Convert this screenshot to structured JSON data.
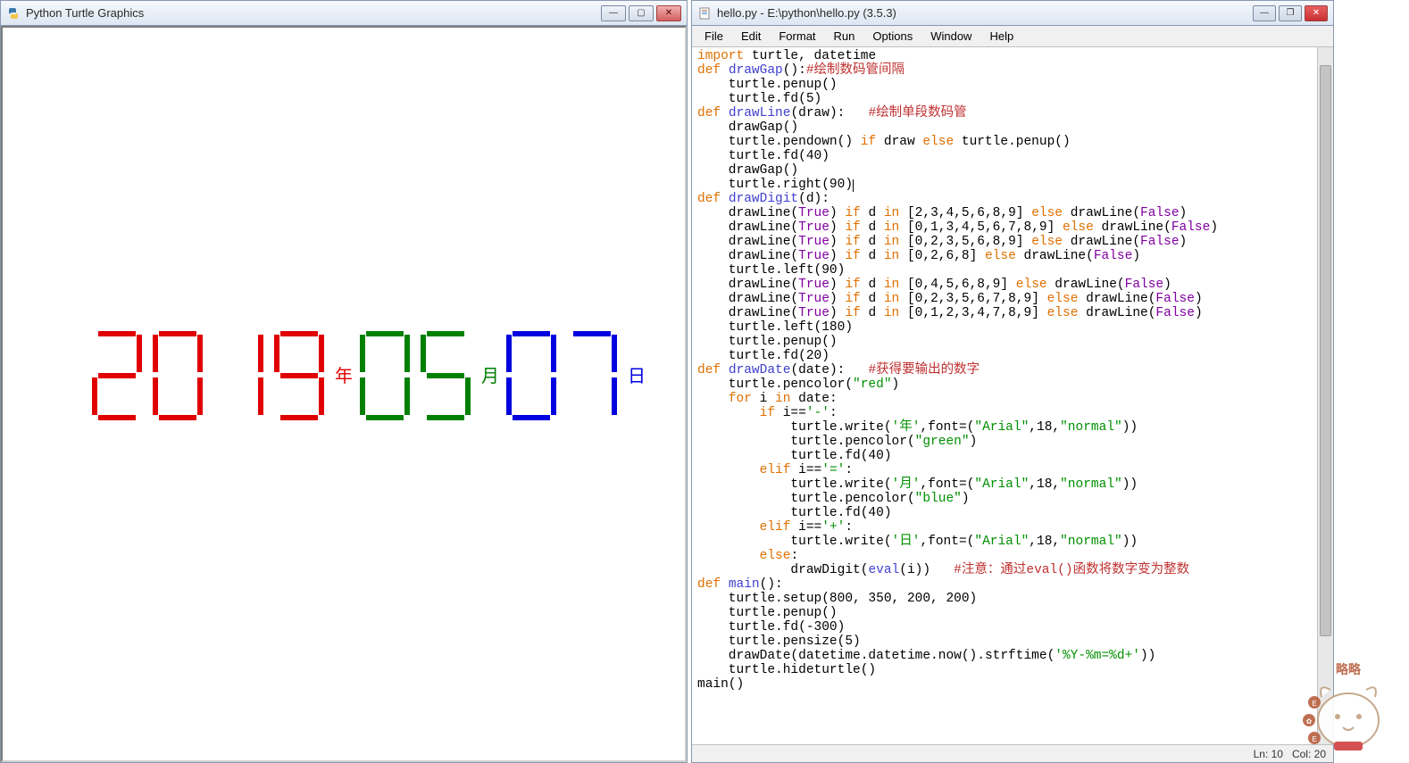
{
  "turtle_window": {
    "title": "Python Turtle Graphics",
    "date": {
      "year": "2019",
      "month": "05",
      "day": "07",
      "year_label": "年",
      "month_label": "月",
      "day_label": "日",
      "year_color": "red",
      "month_color": "green",
      "day_color": "blue"
    }
  },
  "idle_window": {
    "title": "hello.py - E:\\python\\hello.py (3.5.3)",
    "menus": [
      "File",
      "Edit",
      "Format",
      "Run",
      "Options",
      "Window",
      "Help"
    ],
    "status": {
      "ln": "Ln: 10",
      "col": "Col: 20"
    },
    "code_lines": [
      [
        [
          "kw",
          "import"
        ],
        [
          "",
          " turtle, datetime"
        ]
      ],
      [
        [
          "kw",
          "def"
        ],
        [
          "",
          " "
        ],
        [
          "fn",
          "drawGap"
        ],
        [
          "",
          "():"
        ],
        [
          "com",
          "#绘制数码管间隔"
        ]
      ],
      [
        [
          "",
          "    turtle.penup()"
        ]
      ],
      [
        [
          "",
          "    turtle.fd(5)"
        ]
      ],
      [
        [
          "kw",
          "def"
        ],
        [
          "",
          " "
        ],
        [
          "fn",
          "drawLine"
        ],
        [
          "",
          "(draw):   "
        ],
        [
          "com",
          "#绘制单段数码管"
        ]
      ],
      [
        [
          "",
          "    drawGap()"
        ]
      ],
      [
        [
          "",
          "    turtle.pendown() "
        ],
        [
          "kw",
          "if"
        ],
        [
          "",
          " draw "
        ],
        [
          "kw",
          "else"
        ],
        [
          "",
          " turtle.penup()"
        ]
      ],
      [
        [
          "",
          "    turtle.fd(40)"
        ]
      ],
      [
        [
          "",
          "    drawGap()"
        ]
      ],
      [
        [
          "",
          "    turtle.right(90)"
        ]
      ],
      [
        [
          "kw",
          "def"
        ],
        [
          "",
          " "
        ],
        [
          "fn",
          "drawDigit"
        ],
        [
          "",
          "(d):"
        ]
      ],
      [
        [
          "",
          "    drawLine("
        ],
        [
          "bn",
          "True"
        ],
        [
          "",
          ") "
        ],
        [
          "kw",
          "if"
        ],
        [
          "",
          " d "
        ],
        [
          "kw",
          "in"
        ],
        [
          "",
          " [2,3,4,5,6,8,9] "
        ],
        [
          "kw",
          "else"
        ],
        [
          "",
          " drawLine("
        ],
        [
          "bn",
          "False"
        ],
        [
          "",
          ")"
        ]
      ],
      [
        [
          "",
          "    drawLine("
        ],
        [
          "bn",
          "True"
        ],
        [
          "",
          ") "
        ],
        [
          "kw",
          "if"
        ],
        [
          "",
          " d "
        ],
        [
          "kw",
          "in"
        ],
        [
          "",
          " [0,1,3,4,5,6,7,8,9] "
        ],
        [
          "kw",
          "else"
        ],
        [
          "",
          " drawLine("
        ],
        [
          "bn",
          "False"
        ],
        [
          "",
          ")"
        ]
      ],
      [
        [
          "",
          "    drawLine("
        ],
        [
          "bn",
          "True"
        ],
        [
          "",
          ") "
        ],
        [
          "kw",
          "if"
        ],
        [
          "",
          " d "
        ],
        [
          "kw",
          "in"
        ],
        [
          "",
          " [0,2,3,5,6,8,9] "
        ],
        [
          "kw",
          "else"
        ],
        [
          "",
          " drawLine("
        ],
        [
          "bn",
          "False"
        ],
        [
          "",
          ")"
        ]
      ],
      [
        [
          "",
          "    drawLine("
        ],
        [
          "bn",
          "True"
        ],
        [
          "",
          ") "
        ],
        [
          "kw",
          "if"
        ],
        [
          "",
          " d "
        ],
        [
          "kw",
          "in"
        ],
        [
          "",
          " [0,2,6,8] "
        ],
        [
          "kw",
          "else"
        ],
        [
          "",
          " drawLine("
        ],
        [
          "bn",
          "False"
        ],
        [
          "",
          ")"
        ]
      ],
      [
        [
          "",
          "    turtle.left(90)"
        ]
      ],
      [
        [
          "",
          "    drawLine("
        ],
        [
          "bn",
          "True"
        ],
        [
          "",
          ") "
        ],
        [
          "kw",
          "if"
        ],
        [
          "",
          " d "
        ],
        [
          "kw",
          "in"
        ],
        [
          "",
          " [0,4,5,6,8,9] "
        ],
        [
          "kw",
          "else"
        ],
        [
          "",
          " drawLine("
        ],
        [
          "bn",
          "False"
        ],
        [
          "",
          ")"
        ]
      ],
      [
        [
          "",
          "    drawLine("
        ],
        [
          "bn",
          "True"
        ],
        [
          "",
          ") "
        ],
        [
          "kw",
          "if"
        ],
        [
          "",
          " d "
        ],
        [
          "kw",
          "in"
        ],
        [
          "",
          " [0,2,3,5,6,7,8,9] "
        ],
        [
          "kw",
          "else"
        ],
        [
          "",
          " drawLine("
        ],
        [
          "bn",
          "False"
        ],
        [
          "",
          ")"
        ]
      ],
      [
        [
          "",
          "    drawLine("
        ],
        [
          "bn",
          "True"
        ],
        [
          "",
          ") "
        ],
        [
          "kw",
          "if"
        ],
        [
          "",
          " d "
        ],
        [
          "kw",
          "in"
        ],
        [
          "",
          " [0,1,2,3,4,7,8,9] "
        ],
        [
          "kw",
          "else"
        ],
        [
          "",
          " drawLine("
        ],
        [
          "bn",
          "False"
        ],
        [
          "",
          ")"
        ]
      ],
      [
        [
          "",
          "    turtle.left(180)"
        ]
      ],
      [
        [
          "",
          "    turtle.penup()"
        ]
      ],
      [
        [
          "",
          "    turtle.fd(20)"
        ]
      ],
      [
        [
          "kw",
          "def"
        ],
        [
          "",
          " "
        ],
        [
          "fn",
          "drawDate"
        ],
        [
          "",
          "(date):   "
        ],
        [
          "com",
          "#获得要输出的数字"
        ]
      ],
      [
        [
          "",
          "    turtle.pencolor("
        ],
        [
          "str",
          "\"red\""
        ],
        [
          "",
          ")"
        ]
      ],
      [
        [
          "",
          "    "
        ],
        [
          "kw",
          "for"
        ],
        [
          "",
          " i "
        ],
        [
          "kw",
          "in"
        ],
        [
          "",
          " date:"
        ]
      ],
      [
        [
          "",
          "        "
        ],
        [
          "kw",
          "if"
        ],
        [
          "",
          " i=="
        ],
        [
          "str",
          "'-'"
        ],
        [
          "",
          ":"
        ]
      ],
      [
        [
          "",
          "            turtle.write("
        ],
        [
          "str",
          "'年'"
        ],
        [
          "",
          ",font=("
        ],
        [
          "str",
          "\"Arial\""
        ],
        [
          "",
          ",18,"
        ],
        [
          "str",
          "\"normal\""
        ],
        [
          "",
          "))"
        ]
      ],
      [
        [
          "",
          "            turtle.pencolor("
        ],
        [
          "str",
          "\"green\""
        ],
        [
          "",
          ")"
        ]
      ],
      [
        [
          "",
          "            turtle.fd(40)"
        ]
      ],
      [
        [
          "",
          "        "
        ],
        [
          "kw",
          "elif"
        ],
        [
          "",
          " i=="
        ],
        [
          "str",
          "'='"
        ],
        [
          "",
          ":"
        ]
      ],
      [
        [
          "",
          "            turtle.write("
        ],
        [
          "str",
          "'月'"
        ],
        [
          "",
          ",font=("
        ],
        [
          "str",
          "\"Arial\""
        ],
        [
          "",
          ",18,"
        ],
        [
          "str",
          "\"normal\""
        ],
        [
          "",
          "))"
        ]
      ],
      [
        [
          "",
          "            turtle.pencolor("
        ],
        [
          "str",
          "\"blue\""
        ],
        [
          "",
          ")"
        ]
      ],
      [
        [
          "",
          "            turtle.fd(40)"
        ]
      ],
      [
        [
          "",
          "        "
        ],
        [
          "kw",
          "elif"
        ],
        [
          "",
          " i=="
        ],
        [
          "str",
          "'+'"
        ],
        [
          "",
          ":"
        ]
      ],
      [
        [
          "",
          "            turtle.write("
        ],
        [
          "str",
          "'日'"
        ],
        [
          "",
          ",font=("
        ],
        [
          "str",
          "\"Arial\""
        ],
        [
          "",
          ",18,"
        ],
        [
          "str",
          "\"normal\""
        ],
        [
          "",
          "))"
        ]
      ],
      [
        [
          "",
          "        "
        ],
        [
          "kw",
          "else"
        ],
        [
          "",
          ":"
        ]
      ],
      [
        [
          "",
          "            drawDigit("
        ],
        [
          "fn",
          "eval"
        ],
        [
          "",
          "(i))   "
        ],
        [
          "com",
          "#注意：通过eval()函数将数字变为整数"
        ]
      ],
      [
        [
          "kw",
          "def"
        ],
        [
          "",
          " "
        ],
        [
          "fn",
          "main"
        ],
        [
          "",
          "():"
        ]
      ],
      [
        [
          "",
          "    turtle.setup(800, 350, 200, 200)"
        ]
      ],
      [
        [
          "",
          "    turtle.penup()"
        ]
      ],
      [
        [
          "",
          "    turtle.fd(-300)"
        ]
      ],
      [
        [
          "",
          "    turtle.pensize(5)"
        ]
      ],
      [
        [
          "",
          "    drawDate(datetime.datetime.now().strftime("
        ],
        [
          "str",
          "'%Y-%m=%d+'"
        ],
        [
          "",
          "))"
        ]
      ],
      [
        [
          "",
          "    turtle.hideturtle()"
        ]
      ],
      [
        [
          "",
          "main()"
        ]
      ]
    ]
  },
  "watermark_text": "略略"
}
